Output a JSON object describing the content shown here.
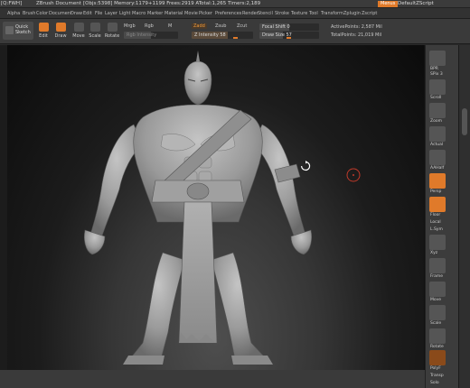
{
  "app": {
    "title_prefix": "[Q:FWH]",
    "title": "ZBrush Document",
    "stats": "[Objs:5398] Memory:1179+1199 Frees:2919 ATotal:1,265 Timers:2,189",
    "menus_button": "Menus",
    "script_label": "DefaultZScript"
  },
  "menubar": {
    "items": [
      "Alpha",
      "Brush",
      "Color",
      "Document",
      "Draw",
      "Edit",
      "File",
      "Layer",
      "Light",
      "Macro",
      "Marker",
      "Material",
      "Movie",
      "Picker",
      "Preferences",
      "Render",
      "Stencil",
      "Stroke",
      "Texture",
      "Tool",
      "Transform",
      "Zplugin",
      "Zscript"
    ]
  },
  "toolbar": {
    "quick_sketch": [
      "Quick",
      "Sketch"
    ],
    "buttons": [
      {
        "label": "Edit",
        "active": true,
        "icon": "edit-icon"
      },
      {
        "label": "Draw",
        "active": true,
        "icon": "draw-icon"
      },
      {
        "label": "Move",
        "active": false,
        "icon": "move-icon"
      },
      {
        "label": "Scale",
        "active": false,
        "icon": "scale-icon"
      },
      {
        "label": "Rotate",
        "active": false,
        "icon": "rotate-icon"
      }
    ],
    "modes": {
      "mrgb": "Mrgb",
      "rgb": "Rgb",
      "m": "M",
      "zadd": "Zadd",
      "zsub": "Zsub",
      "zcut": "Zcut"
    },
    "rgb_intensity": "Rgb Intensity",
    "z_intensity": "Z Intensity 58",
    "focal_shift": "Focal Shift 0",
    "draw_size": "Draw Size 57",
    "active_points": "ActivePoints: 2,587 Mil",
    "total_points": "TotalPoints: 21,019 Mil"
  },
  "right_panel": {
    "labels": [
      "BPR",
      "SPix 3",
      "Scroll",
      "Zoom",
      "Actual",
      "AAHalf",
      "Persp",
      "Floor",
      "Local",
      "L.Sym",
      "Xyz",
      "Frame",
      "Move",
      "Scale",
      "Rotate",
      "PolyF",
      "Transp",
      "Solo"
    ]
  },
  "colors": {
    "accent": "#e07a2a",
    "panel": "#3a3a3a",
    "viewport_bg": "#0b0b0b",
    "model": "#9a9a9a"
  }
}
